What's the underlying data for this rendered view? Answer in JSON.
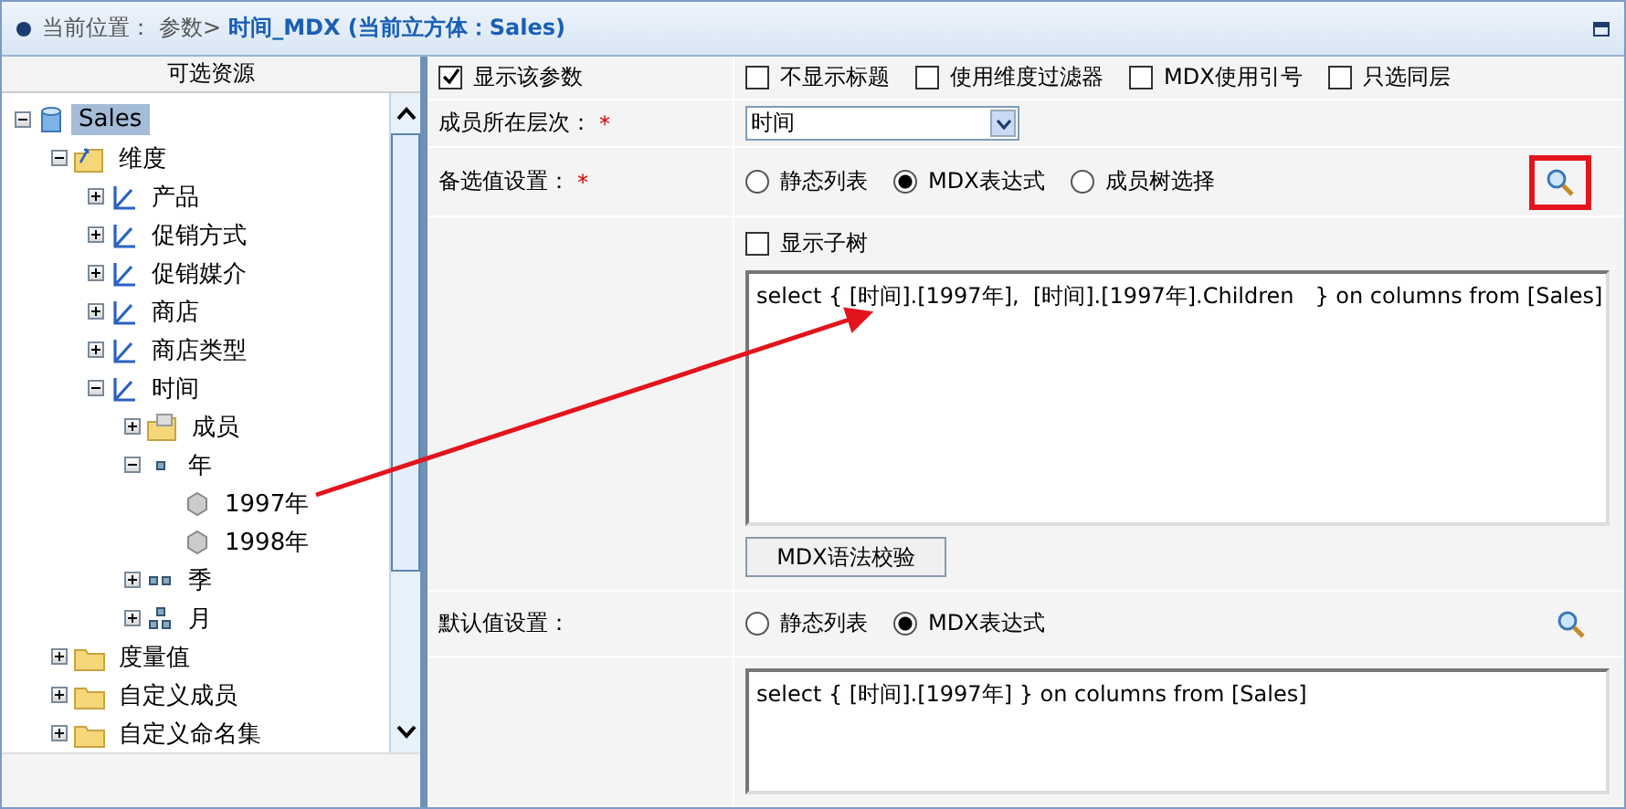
{
  "breadcrumb": {
    "prefix": "当前位置：",
    "path": "参数>",
    "title": "时间_MDX (当前立方体：Sales)"
  },
  "left_panel": {
    "title": "可选资源",
    "tree": [
      {
        "label": "Sales",
        "kind": "cube",
        "selected": true,
        "expanded": true,
        "children": [
          {
            "label": "维度",
            "kind": "dimfolder",
            "selected": false,
            "expanded": true,
            "children": [
              {
                "label": "产品",
                "kind": "dimension",
                "selected": false,
                "expanded": false
              },
              {
                "label": "促销方式",
                "kind": "dimension",
                "selected": false,
                "expanded": false
              },
              {
                "label": "促销媒介",
                "kind": "dimension",
                "selected": false,
                "expanded": false
              },
              {
                "label": "商店",
                "kind": "dimension",
                "selected": false,
                "expanded": false
              },
              {
                "label": "商店类型",
                "kind": "dimension",
                "selected": false,
                "expanded": false
              },
              {
                "label": "时间",
                "kind": "dimension",
                "selected": false,
                "expanded": true,
                "children": [
                  {
                    "label": "成员",
                    "kind": "memberfolder",
                    "selected": false,
                    "expanded": false
                  },
                  {
                    "label": "年",
                    "kind": "level1",
                    "selected": false,
                    "expanded": true,
                    "children": [
                      {
                        "label": "1997年",
                        "kind": "member",
                        "selected": false
                      },
                      {
                        "label": "1998年",
                        "kind": "member",
                        "selected": false
                      }
                    ]
                  },
                  {
                    "label": "季",
                    "kind": "level2",
                    "selected": false,
                    "expanded": false
                  },
                  {
                    "label": "月",
                    "kind": "level3",
                    "selected": false,
                    "expanded": false
                  }
                ]
              }
            ]
          },
          {
            "label": "度量值",
            "kind": "folder",
            "selected": false,
            "expanded": false
          },
          {
            "label": "自定义成员",
            "kind": "folder",
            "selected": false,
            "expanded": false
          },
          {
            "label": "自定义命名集",
            "kind": "folder",
            "selected": false,
            "expanded": false
          }
        ]
      }
    ]
  },
  "options": [
    {
      "label": "显示该参数",
      "checked": true
    },
    {
      "label": "不显示标题",
      "checked": false
    },
    {
      "label": "使用维度过滤器",
      "checked": false
    },
    {
      "label": "MDX使用引号",
      "checked": false
    },
    {
      "label": "只选同层",
      "checked": false
    }
  ],
  "level_field": {
    "label": "成员所在层次：",
    "required": "*",
    "value": "时间"
  },
  "candidate": {
    "label": "备选值设置：",
    "required": "*",
    "modes": [
      {
        "label": "静态列表",
        "selected": false
      },
      {
        "label": "MDX表达式",
        "selected": true
      },
      {
        "label": "成员树选择",
        "selected": false
      }
    ],
    "show_subtree": {
      "label": "显示子树",
      "checked": false
    },
    "mdx": "select { [时间].[1997年],  [时间].[1997年].Children   } on columns from [Sales]",
    "validate_button": "MDX语法校验"
  },
  "default": {
    "label": "默认值设置：",
    "modes": [
      {
        "label": "静态列表",
        "selected": false
      },
      {
        "label": "MDX表达式",
        "selected": true
      }
    ],
    "mdx": "select { [时间].[1997年] } on columns from [Sales]"
  }
}
